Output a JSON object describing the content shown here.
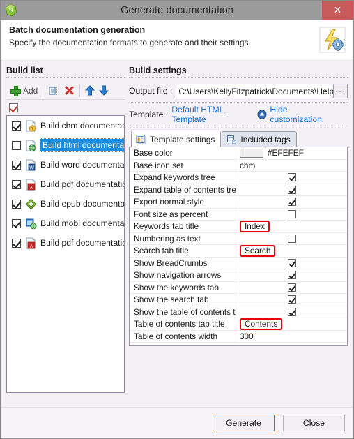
{
  "window": {
    "title": "Generate documentation",
    "app_icon": "green-cube-icon",
    "close_label": "✕"
  },
  "header": {
    "heading": "Batch documentation generation",
    "subheading": "Specify the documentation formats to generate and their settings.",
    "icon": "lightning-gear-icon"
  },
  "build_list": {
    "title": "Build list",
    "toolbar": {
      "add_label": "Add",
      "add_icon": "plus-icon",
      "duplicate_icon": "duplicate-icon",
      "delete_icon": "delete-x-icon",
      "move_up_icon": "arrow-up-icon",
      "move_down_icon": "arrow-down-icon"
    },
    "check_all_icon": "check-all-icon",
    "items": [
      {
        "label": "Build chm documentation",
        "checked": true,
        "selected": false,
        "icon": "chm-doc-icon"
      },
      {
        "label": "Build html documentation",
        "checked": false,
        "selected": true,
        "icon": "html-doc-icon"
      },
      {
        "label": "Build word documentation",
        "checked": true,
        "selected": false,
        "icon": "word-doc-icon"
      },
      {
        "label": "Build pdf documentation",
        "checked": true,
        "selected": false,
        "icon": "pdf-doc-icon"
      },
      {
        "label": "Build epub documentation",
        "checked": true,
        "selected": false,
        "icon": "epub-doc-icon"
      },
      {
        "label": "Build mobi documentation",
        "checked": true,
        "selected": false,
        "icon": "mobi-doc-icon"
      },
      {
        "label": "Build pdf documentation",
        "checked": true,
        "selected": false,
        "icon": "pdf-doc-icon"
      }
    ]
  },
  "build_settings": {
    "title": "Build settings",
    "output_file": {
      "label": "Output file :",
      "value": "C:\\Users\\KellyFitzpatrick\\Documents\\HelpNDo",
      "browse_label": "···"
    },
    "template": {
      "label": "Template :",
      "value": "Default HTML Template",
      "toggle_label": "Hide customization",
      "toggle_icon": "collapse-up-icon"
    },
    "tabs": [
      {
        "label": "Template settings",
        "icon": "template-settings-icon",
        "active": true
      },
      {
        "label": "Included tags",
        "icon": "included-tags-icon",
        "active": false
      }
    ],
    "accent_color": "#EFEFEF",
    "highlight_color": "#E8000A",
    "grid": [
      {
        "name": "Base color",
        "type": "color",
        "value": "#EFEFEF",
        "swatch": "#EFEFEF",
        "highlight": false
      },
      {
        "name": "Base icon set",
        "type": "text",
        "value": "chm",
        "highlight": false
      },
      {
        "name": "Expand keywords tree",
        "type": "checkbox",
        "checked": true,
        "highlight": false
      },
      {
        "name": "Expand table of contents tree",
        "type": "checkbox",
        "checked": true,
        "highlight": false
      },
      {
        "name": "Export normal style",
        "type": "checkbox",
        "checked": true,
        "highlight": false
      },
      {
        "name": "Font size as percent",
        "type": "checkbox",
        "checked": false,
        "highlight": false
      },
      {
        "name": "Keywords tab title",
        "type": "text",
        "value": "Index",
        "highlight": true
      },
      {
        "name": "Numbering as text",
        "type": "checkbox",
        "checked": false,
        "highlight": false
      },
      {
        "name": "Search tab title",
        "type": "text",
        "value": "Search",
        "highlight": true
      },
      {
        "name": "Show BreadCrumbs",
        "type": "checkbox",
        "checked": true,
        "highlight": false
      },
      {
        "name": "Show navigation arrows",
        "type": "checkbox",
        "checked": true,
        "highlight": false
      },
      {
        "name": "Show the keywords tab",
        "type": "checkbox",
        "checked": true,
        "highlight": false
      },
      {
        "name": "Show the search tab",
        "type": "checkbox",
        "checked": true,
        "highlight": false
      },
      {
        "name": "Show the table of contents tab",
        "type": "checkbox",
        "checked": true,
        "highlight": false
      },
      {
        "name": "Table of contents tab title",
        "type": "text",
        "value": "Contents",
        "highlight": true
      },
      {
        "name": "Table of contents width",
        "type": "text",
        "value": "300",
        "highlight": false
      }
    ]
  },
  "footer": {
    "generate_label": "Generate",
    "close_label": "Close"
  }
}
